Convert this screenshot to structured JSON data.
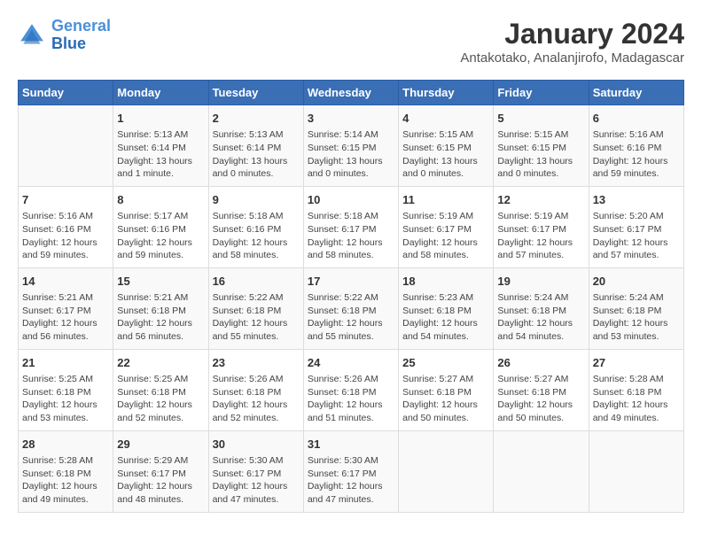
{
  "logo": {
    "line1": "General",
    "line2": "Blue"
  },
  "title": "January 2024",
  "subtitle": "Antakotako, Analanjirofo, Madagascar",
  "days_of_week": [
    "Sunday",
    "Monday",
    "Tuesday",
    "Wednesday",
    "Thursday",
    "Friday",
    "Saturday"
  ],
  "weeks": [
    [
      {
        "day": "",
        "content": ""
      },
      {
        "day": "1",
        "content": "Sunrise: 5:13 AM\nSunset: 6:14 PM\nDaylight: 13 hours\nand 1 minute."
      },
      {
        "day": "2",
        "content": "Sunrise: 5:13 AM\nSunset: 6:14 PM\nDaylight: 13 hours\nand 0 minutes."
      },
      {
        "day": "3",
        "content": "Sunrise: 5:14 AM\nSunset: 6:15 PM\nDaylight: 13 hours\nand 0 minutes."
      },
      {
        "day": "4",
        "content": "Sunrise: 5:15 AM\nSunset: 6:15 PM\nDaylight: 13 hours\nand 0 minutes."
      },
      {
        "day": "5",
        "content": "Sunrise: 5:15 AM\nSunset: 6:15 PM\nDaylight: 13 hours\nand 0 minutes."
      },
      {
        "day": "6",
        "content": "Sunrise: 5:16 AM\nSunset: 6:16 PM\nDaylight: 12 hours\nand 59 minutes."
      }
    ],
    [
      {
        "day": "7",
        "content": "Sunrise: 5:16 AM\nSunset: 6:16 PM\nDaylight: 12 hours\nand 59 minutes."
      },
      {
        "day": "8",
        "content": "Sunrise: 5:17 AM\nSunset: 6:16 PM\nDaylight: 12 hours\nand 59 minutes."
      },
      {
        "day": "9",
        "content": "Sunrise: 5:18 AM\nSunset: 6:16 PM\nDaylight: 12 hours\nand 58 minutes."
      },
      {
        "day": "10",
        "content": "Sunrise: 5:18 AM\nSunset: 6:17 PM\nDaylight: 12 hours\nand 58 minutes."
      },
      {
        "day": "11",
        "content": "Sunrise: 5:19 AM\nSunset: 6:17 PM\nDaylight: 12 hours\nand 58 minutes."
      },
      {
        "day": "12",
        "content": "Sunrise: 5:19 AM\nSunset: 6:17 PM\nDaylight: 12 hours\nand 57 minutes."
      },
      {
        "day": "13",
        "content": "Sunrise: 5:20 AM\nSunset: 6:17 PM\nDaylight: 12 hours\nand 57 minutes."
      }
    ],
    [
      {
        "day": "14",
        "content": "Sunrise: 5:21 AM\nSunset: 6:17 PM\nDaylight: 12 hours\nand 56 minutes."
      },
      {
        "day": "15",
        "content": "Sunrise: 5:21 AM\nSunset: 6:18 PM\nDaylight: 12 hours\nand 56 minutes."
      },
      {
        "day": "16",
        "content": "Sunrise: 5:22 AM\nSunset: 6:18 PM\nDaylight: 12 hours\nand 55 minutes."
      },
      {
        "day": "17",
        "content": "Sunrise: 5:22 AM\nSunset: 6:18 PM\nDaylight: 12 hours\nand 55 minutes."
      },
      {
        "day": "18",
        "content": "Sunrise: 5:23 AM\nSunset: 6:18 PM\nDaylight: 12 hours\nand 54 minutes."
      },
      {
        "day": "19",
        "content": "Sunrise: 5:24 AM\nSunset: 6:18 PM\nDaylight: 12 hours\nand 54 minutes."
      },
      {
        "day": "20",
        "content": "Sunrise: 5:24 AM\nSunset: 6:18 PM\nDaylight: 12 hours\nand 53 minutes."
      }
    ],
    [
      {
        "day": "21",
        "content": "Sunrise: 5:25 AM\nSunset: 6:18 PM\nDaylight: 12 hours\nand 53 minutes."
      },
      {
        "day": "22",
        "content": "Sunrise: 5:25 AM\nSunset: 6:18 PM\nDaylight: 12 hours\nand 52 minutes."
      },
      {
        "day": "23",
        "content": "Sunrise: 5:26 AM\nSunset: 6:18 PM\nDaylight: 12 hours\nand 52 minutes."
      },
      {
        "day": "24",
        "content": "Sunrise: 5:26 AM\nSunset: 6:18 PM\nDaylight: 12 hours\nand 51 minutes."
      },
      {
        "day": "25",
        "content": "Sunrise: 5:27 AM\nSunset: 6:18 PM\nDaylight: 12 hours\nand 50 minutes."
      },
      {
        "day": "26",
        "content": "Sunrise: 5:27 AM\nSunset: 6:18 PM\nDaylight: 12 hours\nand 50 minutes."
      },
      {
        "day": "27",
        "content": "Sunrise: 5:28 AM\nSunset: 6:18 PM\nDaylight: 12 hours\nand 49 minutes."
      }
    ],
    [
      {
        "day": "28",
        "content": "Sunrise: 5:28 AM\nSunset: 6:18 PM\nDaylight: 12 hours\nand 49 minutes."
      },
      {
        "day": "29",
        "content": "Sunrise: 5:29 AM\nSunset: 6:17 PM\nDaylight: 12 hours\nand 48 minutes."
      },
      {
        "day": "30",
        "content": "Sunrise: 5:30 AM\nSunset: 6:17 PM\nDaylight: 12 hours\nand 47 minutes."
      },
      {
        "day": "31",
        "content": "Sunrise: 5:30 AM\nSunset: 6:17 PM\nDaylight: 12 hours\nand 47 minutes."
      },
      {
        "day": "",
        "content": ""
      },
      {
        "day": "",
        "content": ""
      },
      {
        "day": "",
        "content": ""
      }
    ]
  ]
}
